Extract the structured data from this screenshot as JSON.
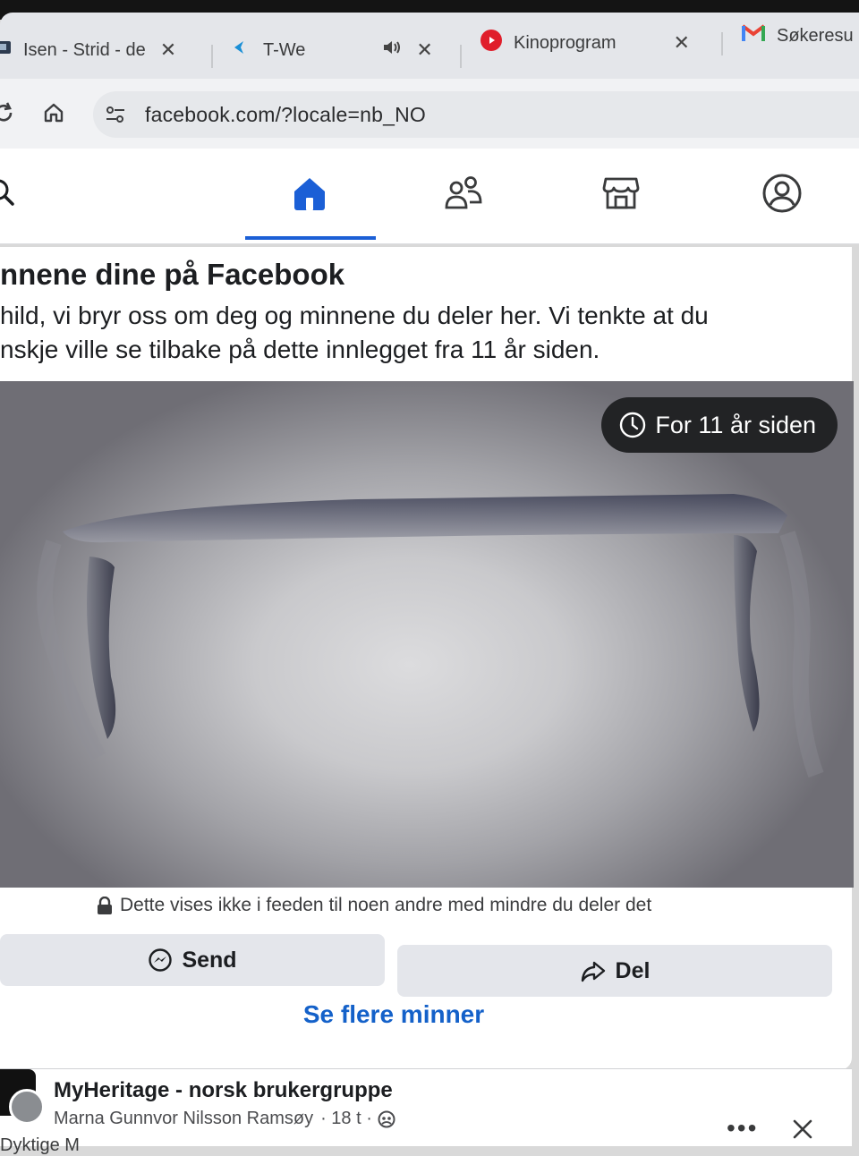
{
  "browser": {
    "tabs": [
      {
        "title": "Isen - Strid - de",
        "favicon": "media-favicon"
      },
      {
        "title": "T-We",
        "favicon": "telenor-favicon",
        "audio": "speaker-icon"
      },
      {
        "title": "Kinoprogram",
        "favicon": "red-circle-favicon"
      },
      {
        "title": "Søkeresu",
        "favicon": "gmail-favicon"
      }
    ],
    "address": "facebook.com/?locale=nb_NO"
  },
  "fb_nav": {
    "items": [
      "search",
      "home",
      "friends",
      "marketplace",
      "profile"
    ],
    "active": "home",
    "accent": "#1b5fd6"
  },
  "memory": {
    "title": "nnene dine på Facebook",
    "text_line1": "hild, vi bryr oss om deg og minnene du deler her. Vi tenkte at du",
    "text_line2": "nskje ville se tilbake på dette innlegget fra 11 år siden.",
    "badge": "For 11 år siden",
    "privacy_note": "Dette vises ikke i feeden til noen andre med mindre du deler det",
    "send_label": "Send",
    "share_label": "Del",
    "more_link": "Se flere minner",
    "link_color": "#1461c9"
  },
  "next_post": {
    "group": "MyHeritage - norsk brukergruppe",
    "author": "Marna Gunnvor Nilsson Ramsøy",
    "time": "· 18 t ·",
    "more": "•••",
    "next_text": "Dyktige M"
  }
}
